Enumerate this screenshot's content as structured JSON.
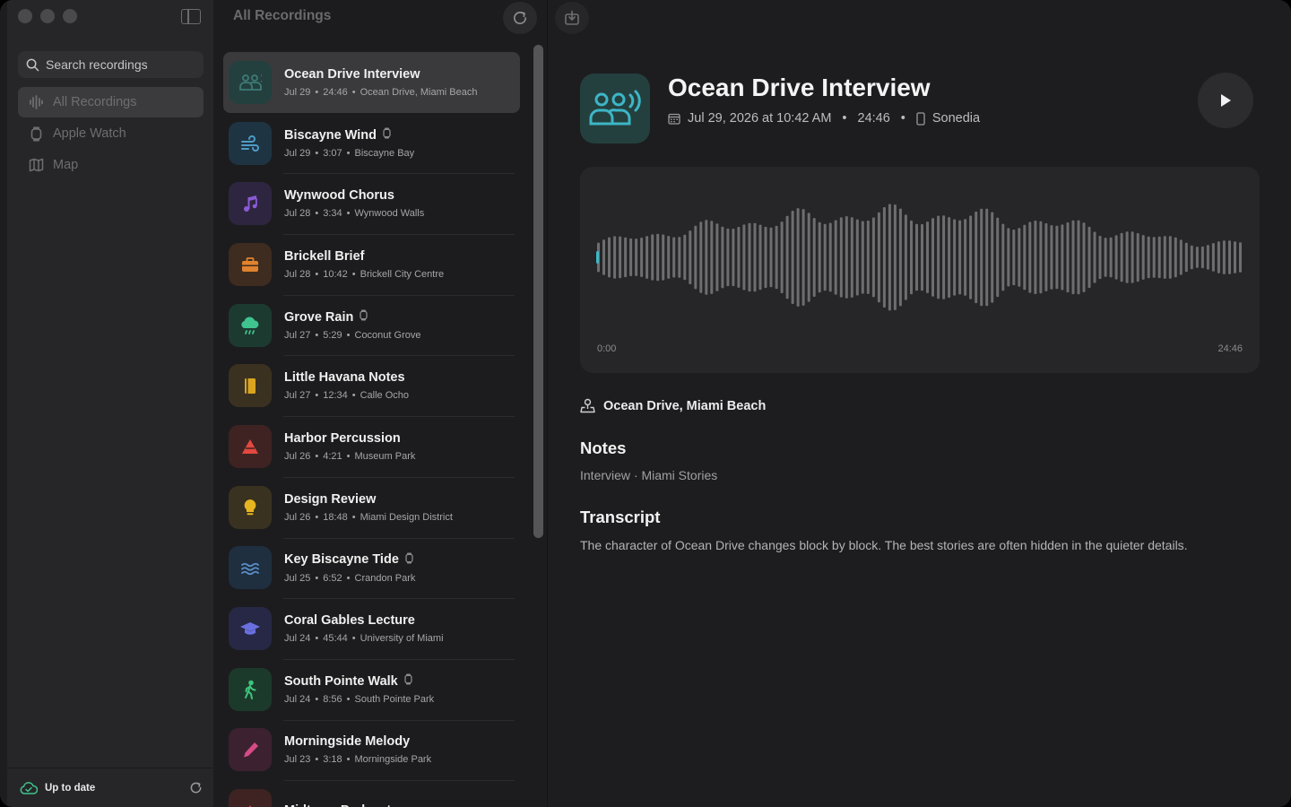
{
  "sidebar": {
    "search_placeholder": "Search recordings",
    "items": [
      {
        "label": "All Recordings",
        "icon": "waveform-icon"
      },
      {
        "label": "Apple Watch",
        "icon": "watch-icon"
      },
      {
        "label": "Map",
        "icon": "map-icon"
      }
    ],
    "footer_status": "Up to date"
  },
  "list": {
    "header": "All Recordings",
    "items": [
      {
        "title": "Ocean Drive Interview",
        "date": "Jul 29",
        "duration": "24:46",
        "location": "Ocean Drive, Miami Beach",
        "icon": "people-speaking-icon",
        "color": "#3d7a76",
        "bg": "#24403e",
        "watch": false
      },
      {
        "title": "Biscayne Wind",
        "date": "Jul 29",
        "duration": "3:07",
        "location": "Biscayne Bay",
        "icon": "wind-icon",
        "color": "#4f9bc7",
        "bg": "#1f3442",
        "watch": true
      },
      {
        "title": "Wynwood Chorus",
        "date": "Jul 28",
        "duration": "3:34",
        "location": "Wynwood Walls",
        "icon": "music-note-icon",
        "color": "#8a5bd6",
        "bg": "#2e2640",
        "watch": false
      },
      {
        "title": "Brickell Brief",
        "date": "Jul 28",
        "duration": "10:42",
        "location": "Brickell City Centre",
        "icon": "briefcase-icon",
        "color": "#e0822e",
        "bg": "#3d2c1f",
        "watch": false
      },
      {
        "title": "Grove Rain",
        "date": "Jul 27",
        "duration": "5:29",
        "location": "Coconut Grove",
        "icon": "cloud-rain-icon",
        "color": "#3fc48f",
        "bg": "#1d3a31",
        "watch": true
      },
      {
        "title": "Little Havana Notes",
        "date": "Jul 27",
        "duration": "12:34",
        "location": "Calle Ocho",
        "icon": "book-icon",
        "color": "#d9a521",
        "bg": "#3a3120",
        "watch": false
      },
      {
        "title": "Harbor Percussion",
        "date": "Jul 26",
        "duration": "4:21",
        "location": "Museum Park",
        "icon": "drum-icon",
        "color": "#e2493f",
        "bg": "#3e2322",
        "watch": false
      },
      {
        "title": "Design Review",
        "date": "Jul 26",
        "duration": "18:48",
        "location": "Miami Design District",
        "icon": "lightbulb-icon",
        "color": "#e7b51f",
        "bg": "#3a3220",
        "watch": false
      },
      {
        "title": "Key Biscayne Tide",
        "date": "Jul 25",
        "duration": "6:52",
        "location": "Crandon Park",
        "icon": "waves-icon",
        "color": "#5a8fc9",
        "bg": "#1f2f40",
        "watch": true
      },
      {
        "title": "Coral Gables Lecture",
        "date": "Jul 24",
        "duration": "45:44",
        "location": "University of Miami",
        "icon": "graduation-cap-icon",
        "color": "#6a6fe0",
        "bg": "#262845",
        "watch": false
      },
      {
        "title": "South Pointe Walk",
        "date": "Jul 24",
        "duration": "8:56",
        "location": "South Pointe Park",
        "icon": "walking-icon",
        "color": "#3ec47c",
        "bg": "#1c3a2b",
        "watch": true
      },
      {
        "title": "Morningside Melody",
        "date": "Jul 23",
        "duration": "3:18",
        "location": "Morningside Park",
        "icon": "pen-icon",
        "color": "#d44c86",
        "bg": "#3c2130",
        "watch": false
      },
      {
        "title": "Midtown Podcast",
        "date": "",
        "duration": "",
        "location": "",
        "icon": "mic-icon",
        "color": "#e2493f",
        "bg": "#3e2322",
        "watch": false
      }
    ]
  },
  "detail": {
    "title": "Ocean Drive Interview",
    "datetime": "Jul 29, 2026 at 10:42 AM",
    "duration": "24:46",
    "device": "Sonedia",
    "wave_start": "0:00",
    "wave_end": "24:46",
    "location": "Ocean Drive, Miami Beach",
    "notes_heading": "Notes",
    "notes": "Interview · Miami Stories",
    "transcript_heading": "Transcript",
    "transcript": "The character of Ocean Drive changes block by block. The best stories are often hidden in the quieter details.",
    "playhead": 0.0
  },
  "colors": {
    "accent": "#3db6c6",
    "waveform": "#6e6e70"
  }
}
